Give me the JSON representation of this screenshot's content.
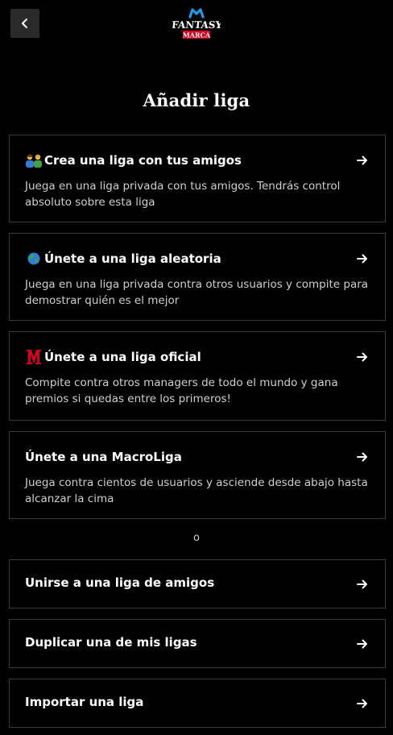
{
  "header": {
    "back_icon": "chevron-left-icon",
    "logo": {
      "brand_mark": "M",
      "line1": "FANTASY",
      "line2": "MARCA"
    }
  },
  "title": "Añadir liga",
  "cards": [
    {
      "icon": "friends-emoji-icon",
      "title": "Crea una liga con tus amigos",
      "description": "Juega en una liga privada con tus amigos. Tendrás control absoluto sobre esta liga"
    },
    {
      "icon": "globe-icon",
      "title": "Únete a una liga aleatoria",
      "description": "Juega en una liga privada contra otros usuarios y compite para demostrar quién es el mejor"
    },
    {
      "icon": "marca-m-icon",
      "title": "Únete a una liga oficial",
      "description": "Compite contra otros managers de todo el mundo y gana premios si quedas entre los primeros!"
    },
    {
      "icon": "",
      "title": "Únete a una MacroLiga",
      "description": "Juega contra cientos de usuarios y asciende desde abajo hasta alcanzar la cima"
    }
  ],
  "separator": "o",
  "actions": [
    {
      "label": "Unirse a una liga de amigos"
    },
    {
      "label": "Duplicar una de mis ligas"
    },
    {
      "label": "Importar una liga"
    }
  ],
  "colors": {
    "background": "#000000",
    "card_border": "#3a3a3a",
    "description_text": "#cfcfcf",
    "brand_blue": "#1e9be6",
    "brand_red": "#d6001c"
  }
}
